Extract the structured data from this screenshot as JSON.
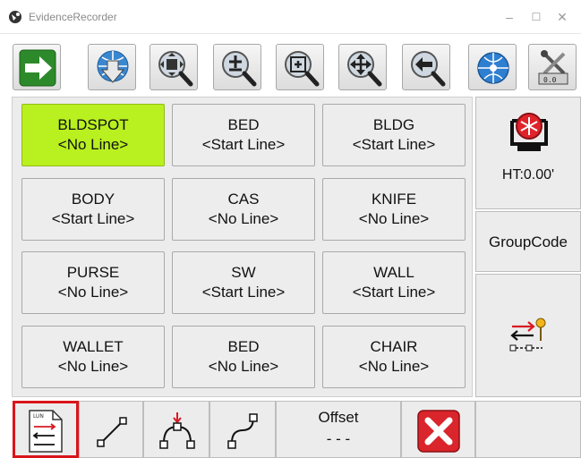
{
  "window": {
    "title": "EvidenceRecorder",
    "controls": [
      "–",
      "☐",
      "✕"
    ]
  },
  "toolbar": {
    "buttons": [
      {
        "name": "next-arrow-icon"
      },
      {
        "name": "import-globe-icon"
      },
      {
        "name": "zoom-extents-icon"
      },
      {
        "name": "zoom-in-icon"
      },
      {
        "name": "zoom-window-icon"
      },
      {
        "name": "pan-icon"
      },
      {
        "name": "zoom-previous-icon"
      },
      {
        "name": "globe-icon"
      },
      {
        "name": "settings-tools-icon"
      }
    ]
  },
  "evidence": [
    {
      "code": "BLDSPOT",
      "status": "<No Line>",
      "active": true
    },
    {
      "code": "BED",
      "status": "<Start Line>"
    },
    {
      "code": "BLDG",
      "status": "<Start Line>"
    },
    {
      "code": "BODY",
      "status": "<Start Line>"
    },
    {
      "code": "CAS",
      "status": "<No Line>"
    },
    {
      "code": "KNIFE",
      "status": "<No Line>"
    },
    {
      "code": "PURSE",
      "status": "<No Line>"
    },
    {
      "code": "SW",
      "status": "<Start Line>"
    },
    {
      "code": "WALL",
      "status": "<Start Line>"
    },
    {
      "code": "WALLET",
      "status": "<No Line>"
    },
    {
      "code": "BED",
      "status": "<No Line>"
    },
    {
      "code": "CHAIR",
      "status": "<No Line>"
    }
  ],
  "side": {
    "height_label": "HT:0.00'",
    "group_code_label": "GroupCode"
  },
  "bottom": {
    "offset_label": "Offset",
    "offset_value": "- - -"
  },
  "colors": {
    "active_cell": "#b9f01f",
    "selected_outline": "#d9141b",
    "close_red": "#d9252b"
  }
}
